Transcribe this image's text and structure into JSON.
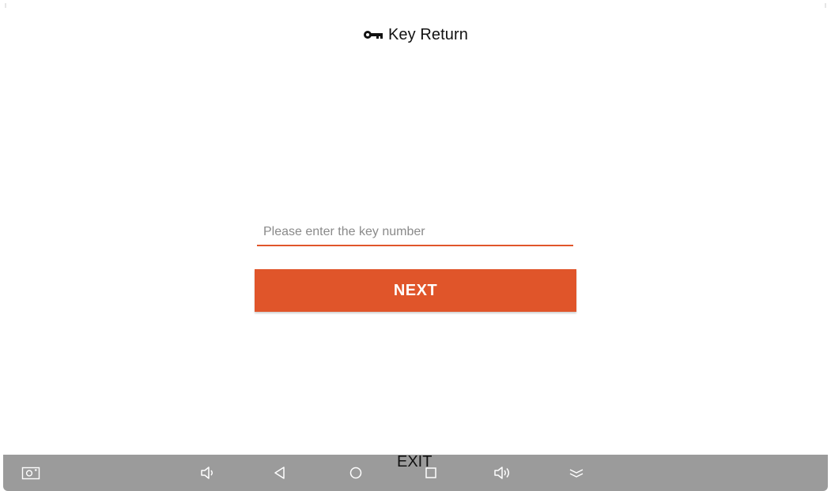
{
  "header": {
    "title": "Key Return",
    "icon": "key-icon"
  },
  "form": {
    "key_input": {
      "value": "",
      "placeholder": "Please enter the key number"
    },
    "next_label": "NEXT"
  },
  "exit_label": "EXIT",
  "nav_bar": {
    "buttons": [
      "screenshot-icon",
      "volume-down-icon",
      "back-icon",
      "home-icon",
      "recents-icon",
      "volume-up-icon",
      "collapse-icon"
    ]
  },
  "colors": {
    "accent": "#e0552a",
    "nav_bar": "#9b9b9b",
    "background": "#ffffff",
    "text": "#111111"
  }
}
